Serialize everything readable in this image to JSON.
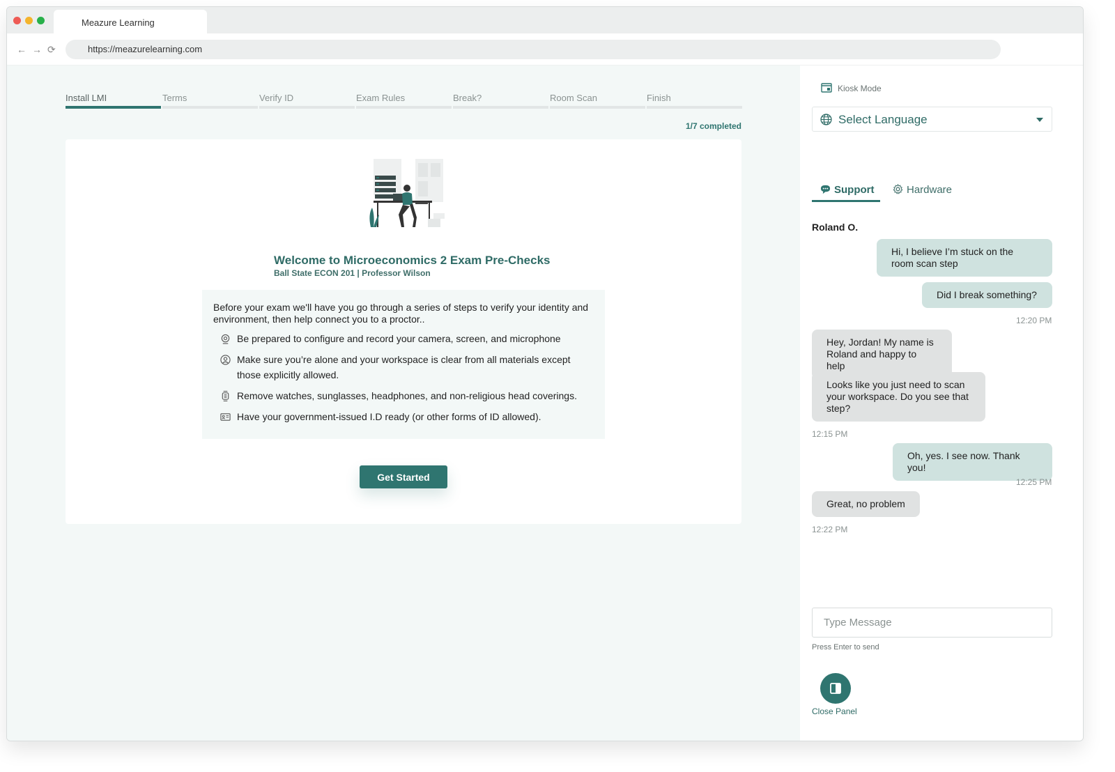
{
  "browser": {
    "tab_title": "Meazure Learning",
    "url": "https://meazurelearning.com",
    "back_icon": "←",
    "forward_icon": "→",
    "reload_icon": "⟳"
  },
  "steps": [
    {
      "label": "Install LMI",
      "active": true
    },
    {
      "label": "Terms",
      "active": false
    },
    {
      "label": "Verify ID",
      "active": false
    },
    {
      "label": "Exam Rules",
      "active": false
    },
    {
      "label": "Break?",
      "active": false
    },
    {
      "label": "Room Scan",
      "active": false
    },
    {
      "label": "Finish",
      "active": false
    }
  ],
  "progress": {
    "text": "1/7 completed",
    "completed": 1,
    "total": 7
  },
  "welcome": {
    "title": "Welcome to Microeconomics 2 Exam Pre-Checks",
    "subtitle": "Ball State ECON 201 | Professor Wilson",
    "intro": "Before your exam we'll have you go through a series of steps to verify your identity and environment, then help connect you to a proctor..",
    "bullets": [
      {
        "icon": "webcam-icon",
        "text": "Be prepared to configure and record your camera, screen, and microphone"
      },
      {
        "icon": "person-icon",
        "text": "Make sure you’re alone and your workspace is clear from all materials except those explicitly allowed."
      },
      {
        "icon": "watch-icon",
        "text": "Remove watches, sunglasses, headphones, and non-religious head coverings."
      },
      {
        "icon": "id-card-icon",
        "text": "Have your government-issued I.D ready (or other forms of ID allowed)."
      }
    ],
    "button": "Get Started"
  },
  "side": {
    "kiosk": "Kiosk Mode",
    "language": "Select Language",
    "tab_support": "Support",
    "tab_hardware": "Hardware",
    "agent": "Roland O.",
    "messages": [
      {
        "from": "me",
        "text": "Hi, I believe I’m stuck on the room scan step"
      },
      {
        "from": "me",
        "text": "Did I break something?"
      },
      {
        "time": "12:20 PM"
      },
      {
        "from": "them",
        "text": "Hey, Jordan! My name is Roland and happy to help"
      },
      {
        "from": "them",
        "text": "Looks like you just need to scan your workspace. Do you see that step?"
      },
      {
        "time": "12:15 PM"
      },
      {
        "from": "me",
        "text": "Oh, yes. I see now. Thank you!"
      },
      {
        "time": "12:25 PM"
      },
      {
        "from": "them",
        "text": "Great, no problem"
      },
      {
        "time": "12:22 PM"
      }
    ],
    "input_placeholder": "Type Message",
    "hint": "Press Enter to send",
    "close_label": "Close Panel"
  },
  "colors": {
    "accent": "#2f7570",
    "bubble_me": "#cfe2df",
    "bubble_them": "#e0e2e2",
    "page_bg": "#f3f8f7"
  }
}
